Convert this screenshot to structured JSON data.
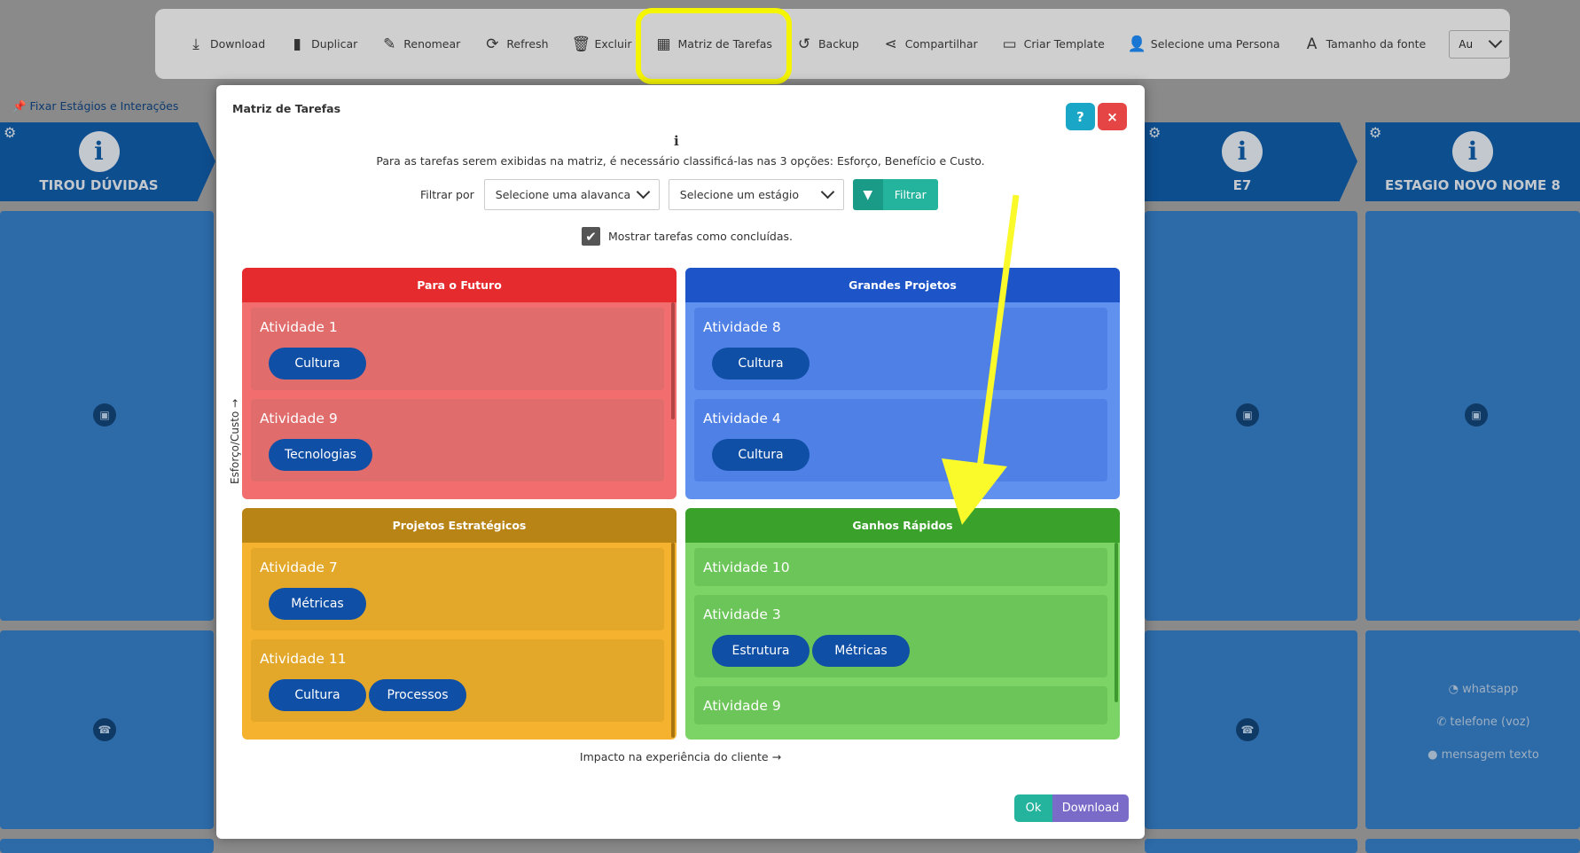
{
  "toolbar": {
    "items": [
      {
        "label": "Download",
        "icon": "download-icon"
      },
      {
        "label": "Duplicar",
        "icon": "file-icon"
      },
      {
        "label": "Renomear",
        "icon": "edit-icon"
      },
      {
        "label": "Refresh",
        "icon": "refresh-icon"
      },
      {
        "label": "Excluir",
        "icon": "trash-icon"
      },
      {
        "label": "Matriz de Tarefas",
        "icon": "grid-icon"
      },
      {
        "label": "Backup",
        "icon": "backup-icon"
      },
      {
        "label": "Compartilhar",
        "icon": "share-icon"
      },
      {
        "label": "Criar Template",
        "icon": "template-icon"
      },
      {
        "label": "Selecione uma Persona",
        "icon": "user-plus-icon"
      },
      {
        "label": "Tamanho da fonte",
        "icon": "font-icon"
      }
    ],
    "font_select_value": "Au"
  },
  "pin_link": "Fixar Estágios e Interações",
  "stages": {
    "left": "TIROU DÚVIDAS",
    "e7": "E7",
    "last": "ESTAGIO NOVO NOME 8"
  },
  "contacts": [
    "whatsapp",
    "telefone (voz)",
    "mensagem texto"
  ],
  "modal": {
    "title": "Matriz de Tarefas",
    "help_label": "?",
    "close_label": "×",
    "info_icon": "i",
    "info_text": "Para as tarefas serem exibidas na matriz, é necessário classificá-las nas 3 opções: Esforço, Benefício e Custo.",
    "filter": {
      "label": "Filtrar por",
      "lever_select": "Selecione uma alavanca",
      "stage_select": "Selecione um estágio",
      "button": "Filtrar"
    },
    "show_completed": "Mostrar tarefas como concluídas.",
    "y_axis": "Esforço/Custo →",
    "x_axis": "Impacto na experiência do cliente →",
    "quadrants": {
      "red": {
        "title": "Para o Futuro",
        "tasks": [
          {
            "title": "Atividade 1",
            "tags": [
              "Cultura"
            ]
          },
          {
            "title": "Atividade 9",
            "tags": [
              "Tecnologias"
            ]
          }
        ]
      },
      "blue": {
        "title": "Grandes Projetos",
        "tasks": [
          {
            "title": "Atividade 8",
            "tags": [
              "Cultura"
            ]
          },
          {
            "title": "Atividade 4",
            "tags": [
              "Cultura"
            ]
          }
        ]
      },
      "orange": {
        "title": "Projetos Estratégicos",
        "tasks": [
          {
            "title": "Atividade 7",
            "tags": [
              "Métricas"
            ]
          },
          {
            "title": "Atividade 11",
            "tags": [
              "Cultura",
              "Processos"
            ]
          }
        ]
      },
      "green": {
        "title": "Ganhos Rápidos",
        "tasks": [
          {
            "title": "Atividade 10",
            "tags": []
          },
          {
            "title": "Atividade 3",
            "tags": [
              "Estrutura",
              "Métricas"
            ]
          },
          {
            "title": "Atividade 9",
            "tags": []
          }
        ]
      }
    },
    "ok_label": "Ok",
    "download_label": "Download"
  },
  "colors": {
    "highlight": "#f5f500",
    "red_header": "#e62b2f",
    "blue_header": "#1d55c8",
    "orange_header": "#b88416",
    "green_header": "#3aa22a",
    "tag": "#0f4fa5"
  }
}
